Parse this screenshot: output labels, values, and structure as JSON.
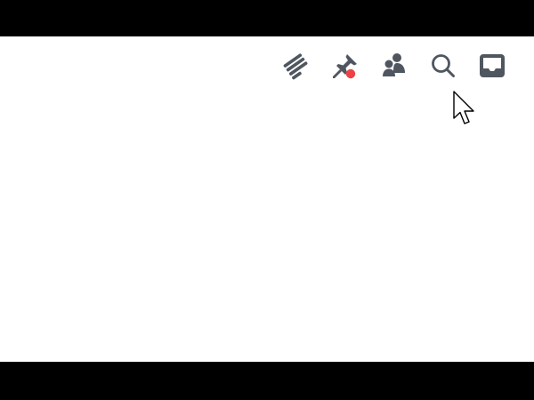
{
  "toolbar": {
    "items": [
      {
        "name": "threads",
        "icon": "threads-icon"
      },
      {
        "name": "pinned-messages",
        "icon": "pin-icon",
        "has_notification_dot": true
      },
      {
        "name": "member-list",
        "icon": "members-icon"
      },
      {
        "name": "search",
        "icon": "search-icon"
      },
      {
        "name": "inbox",
        "icon": "inbox-icon"
      }
    ]
  },
  "colors": {
    "icon": "#4f5660",
    "notification_dot": "#ed4245",
    "background": "#ffffff",
    "letterbox": "#000000"
  },
  "cursor": {
    "icon": "arrow-pointer-icon"
  }
}
